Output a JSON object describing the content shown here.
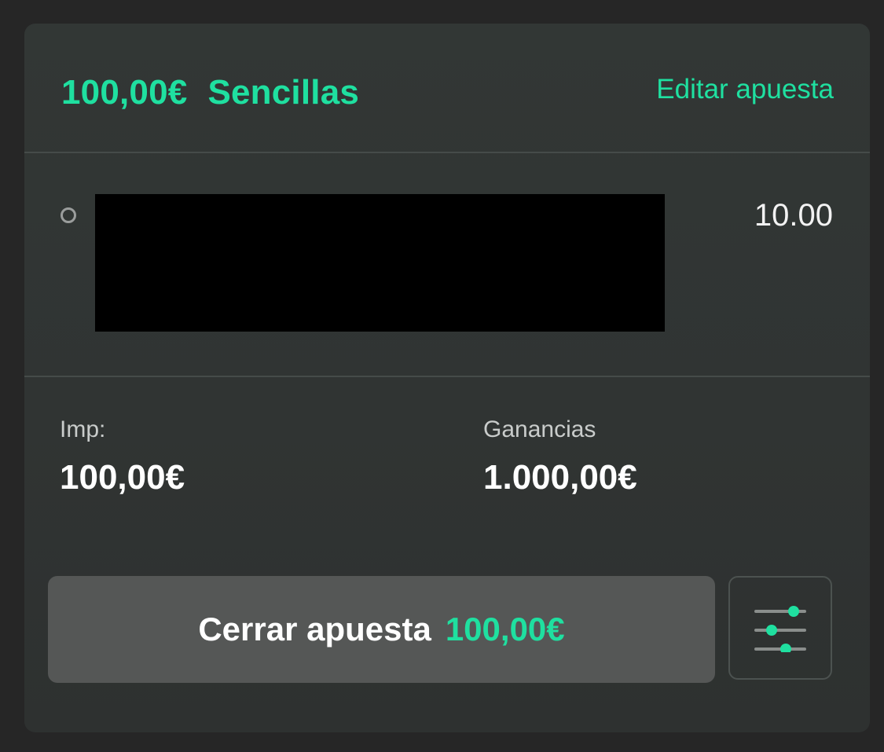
{
  "header": {
    "stake": "100,00€",
    "bet_type": "Sencillas",
    "edit_label": "Editar apuesta"
  },
  "selection": {
    "odds": "10.00"
  },
  "stats": {
    "stake_label": "Imp:",
    "stake_value": "100,00€",
    "winnings_label": "Ganancias",
    "winnings_value": "1.000,00€"
  },
  "actions": {
    "cashout_label": "Cerrar apuesta",
    "cashout_amount": "100,00€",
    "settings_icon": "sliders-icon"
  },
  "colors": {
    "accent": "#1fe0a0",
    "card": "#313634",
    "background": "#262626",
    "button": "#555756"
  }
}
